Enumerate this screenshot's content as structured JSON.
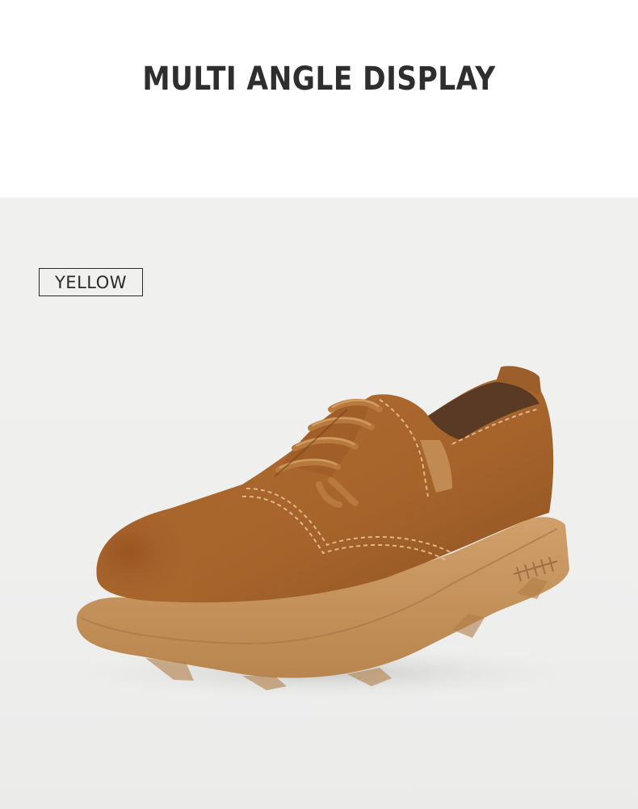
{
  "header": {
    "title": "MULTI ANGLE DISPLAY"
  },
  "product": {
    "color_label": "YELLOW",
    "image_subject": "shoe-image"
  },
  "colors": {
    "background_top": "#ffffff",
    "background_photo": "#efefee",
    "title_text": "#2e2e2e",
    "leather": "#a8662c",
    "sole": "#c9955e"
  }
}
